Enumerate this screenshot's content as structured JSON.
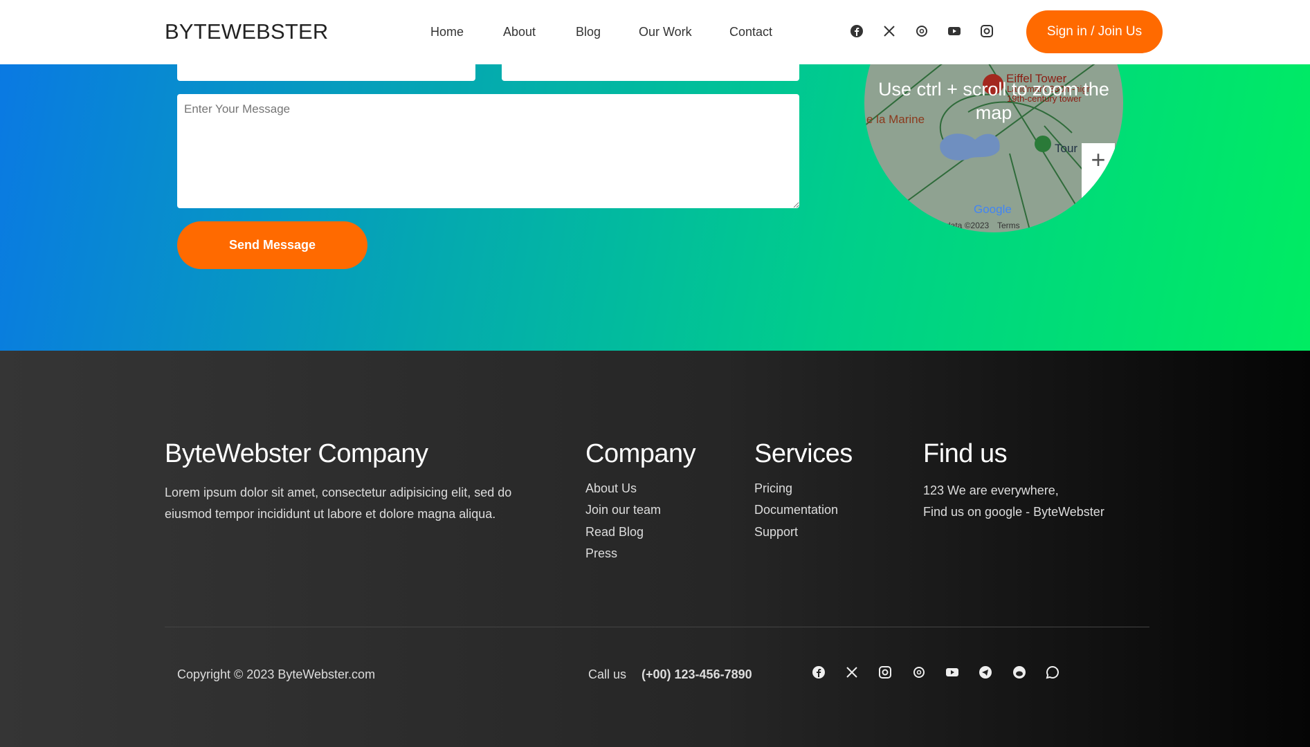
{
  "header": {
    "logo": "BYTEWEBSTER",
    "nav": [
      "Home",
      "About",
      "Blog",
      "Our Work",
      "Contact"
    ],
    "social": [
      "facebook-icon",
      "x-icon",
      "threads-icon",
      "youtube-icon",
      "instagram-icon"
    ],
    "signin": "Sign in / Join Us"
  },
  "form": {
    "message_placeholder": "Enter Your Message",
    "send": "Send Message"
  },
  "map": {
    "tip": "Use ctrl + scroll to zoom the map",
    "labels": [
      "Eiffel Tower",
      "Landmark 330m-high 19th-century tower",
      "e la Marine",
      "Tour",
      "Google",
      "data ©2023",
      "Terms"
    ]
  },
  "footer": {
    "brand": "ByteWebster Company",
    "about": "Lorem ipsum dolor sit amet, consectetur adipisicing elit, sed do eiusmod tempor incididunt ut labore et dolore magna aliqua.",
    "company": {
      "title": "Company",
      "links": [
        "About Us",
        "Join our team",
        "Read Blog",
        "Press"
      ]
    },
    "services": {
      "title": "Services",
      "links": [
        "Pricing",
        "Documentation",
        "Support"
      ]
    },
    "find": {
      "title": "Find us",
      "lines": [
        "123 We are everywhere,",
        "Find us on google - ByteWebster"
      ]
    },
    "copyright": "Copyright © 2023 ByteWebster.com",
    "call_label": "Call us",
    "phone": "(+00) 123-456-7890",
    "social": [
      "facebook-icon",
      "x-icon",
      "instagram-icon",
      "threads-icon",
      "youtube-icon",
      "telegram-icon",
      "reddit-icon",
      "whatsapp-icon"
    ]
  },
  "colors": {
    "accent": "#ff6a00",
    "gradient_start": "#0a78e4",
    "gradient_end": "#00ec62"
  }
}
